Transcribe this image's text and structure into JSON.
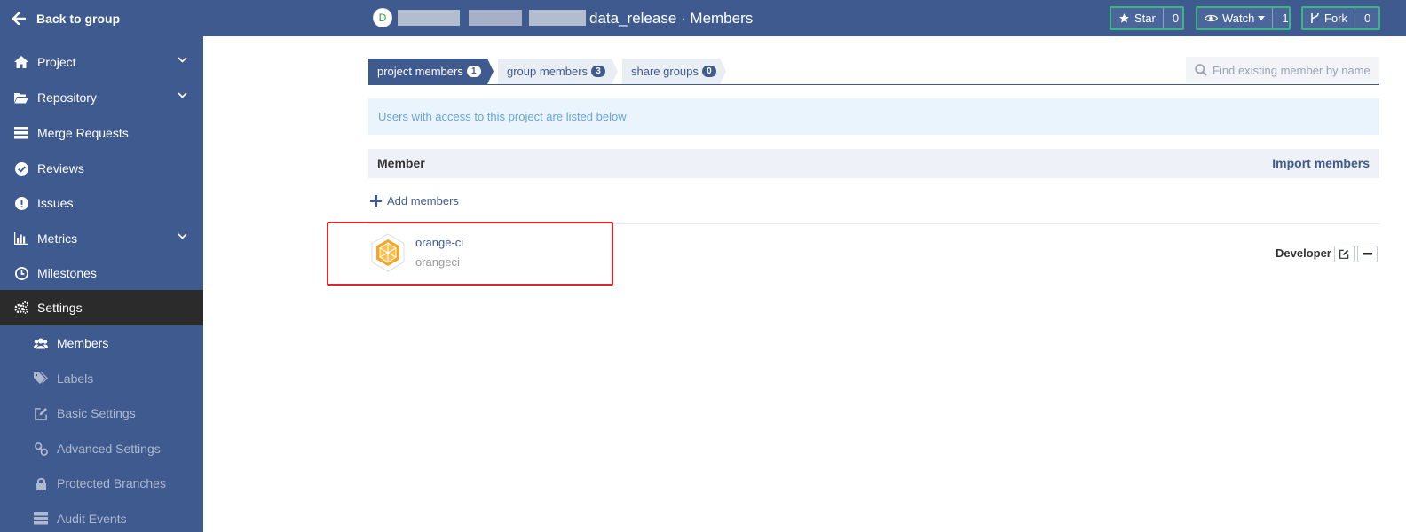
{
  "topbar": {
    "back_label": "Back to group",
    "project_initial": "D",
    "page_title": "data_release · Members",
    "star": {
      "label": "Star",
      "count": "0"
    },
    "watch": {
      "label": "Watch",
      "count": "1"
    },
    "fork": {
      "label": "Fork",
      "count": "0"
    }
  },
  "sidebar": {
    "items": [
      {
        "label": "Project"
      },
      {
        "label": "Repository"
      },
      {
        "label": "Merge Requests"
      },
      {
        "label": "Reviews"
      },
      {
        "label": "Issues"
      },
      {
        "label": "Metrics"
      },
      {
        "label": "Milestones"
      },
      {
        "label": "Settings"
      }
    ],
    "settings_children": [
      {
        "label": "Members"
      },
      {
        "label": "Labels"
      },
      {
        "label": "Basic Settings"
      },
      {
        "label": "Advanced Settings"
      },
      {
        "label": "Protected Branches"
      },
      {
        "label": "Audit Events"
      }
    ]
  },
  "tabs": [
    {
      "label": "project members",
      "count": "1"
    },
    {
      "label": "group members",
      "count": "3"
    },
    {
      "label": "share groups",
      "count": "0"
    }
  ],
  "search": {
    "placeholder": "Find existing member by name"
  },
  "info_text": "Users with access to this project are listed below",
  "member_header": {
    "title": "Member",
    "import_label": "Import members"
  },
  "add_members_label": "Add members",
  "members": [
    {
      "name": "orange-ci",
      "login": "orangeci",
      "role": "Developer"
    }
  ],
  "colors": {
    "primary": "#3f5a8e",
    "active_nav": "#2b2b2b",
    "highlight": "#e0242b",
    "accent_border": "#3fb586"
  }
}
